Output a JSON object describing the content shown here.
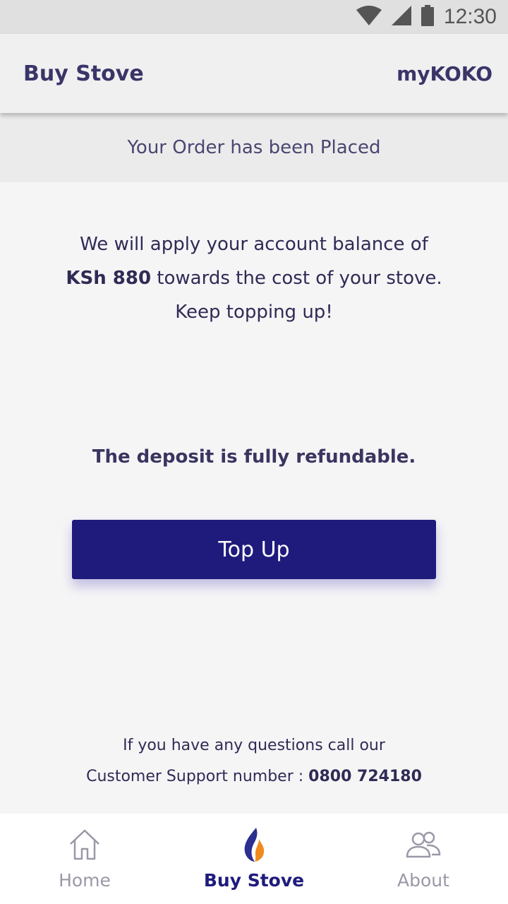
{
  "status_bar": {
    "time": "12:30"
  },
  "app_bar": {
    "title": "Buy Stove",
    "brand": "myKOKO"
  },
  "banner": {
    "text": "Your Order has been Placed"
  },
  "message": {
    "line1": "We will apply your account balance of",
    "amount": "KSh 880",
    "line2_rest": " towards the cost of your stove.",
    "line3": "Keep topping up!"
  },
  "refund_note": "The deposit is fully refundable.",
  "topup_button": {
    "label": "Top Up"
  },
  "support": {
    "line1": "If you have any questions call our",
    "line2_prefix": "Customer Support number : ",
    "phone": "0800 724180"
  },
  "bottom_nav": {
    "items": [
      {
        "label": "Home",
        "icon": "home-icon",
        "active": false
      },
      {
        "label": "Buy Stove",
        "icon": "flame-icon",
        "active": true
      },
      {
        "label": "About",
        "icon": "people-icon",
        "active": false
      }
    ]
  },
  "colors": {
    "primary": "#1f1b7d",
    "text": "#3a3560",
    "inactive_nav": "#9a98a8",
    "flame_blue": "#2b2f8f",
    "flame_orange": "#f08a1c"
  }
}
